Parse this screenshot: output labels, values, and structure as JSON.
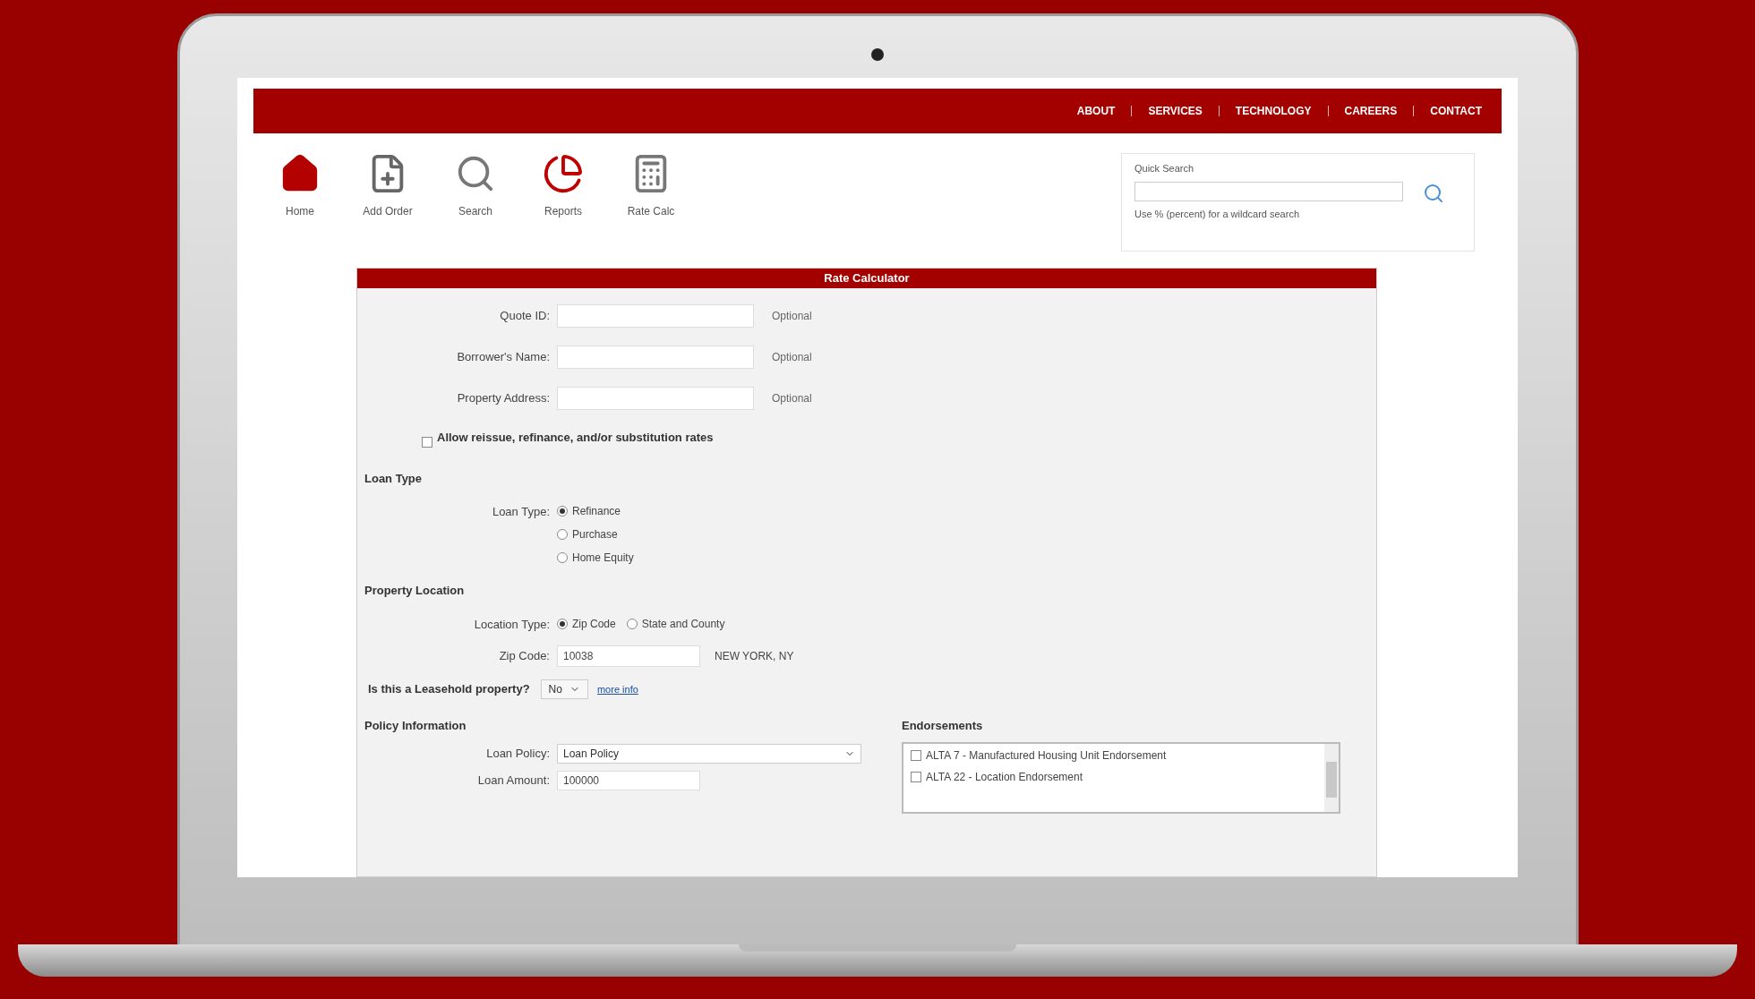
{
  "nav": {
    "links": [
      "ABOUT",
      "SERVICES",
      "TECHNOLOGY",
      "CAREERS",
      "CONTACT"
    ]
  },
  "toolbar": [
    {
      "kind": "home",
      "label": "Home"
    },
    {
      "kind": "order",
      "label": "Add Order"
    },
    {
      "kind": "search",
      "label": "Search"
    },
    {
      "kind": "reports",
      "label": "Reports"
    },
    {
      "kind": "calc",
      "label": "Rate Calc"
    }
  ],
  "quick_search": {
    "label": "Quick Search",
    "hint": "Use % (percent) for a wildcard search"
  },
  "form": {
    "title": "Rate Calculator",
    "fields": [
      {
        "label": "Quote ID:",
        "note": "Optional"
      },
      {
        "label": "Borrower's Name:",
        "note": "Optional"
      },
      {
        "label": "Property Address:",
        "note": "Optional"
      }
    ],
    "allow_reissue": {
      "label": "Allow reissue, refinance, and/or substitution rates",
      "checked": false
    },
    "loan_type": {
      "heading": "Loan Type",
      "label": "Loan Type:",
      "options": [
        {
          "label": "Refinance",
          "selected": true
        },
        {
          "label": "Purchase",
          "selected": false
        },
        {
          "label": "Home Equity",
          "selected": false
        }
      ]
    },
    "property_location": {
      "heading": "Property Location",
      "label": "Location Type:",
      "options": [
        {
          "label": "Zip Code",
          "selected": true
        },
        {
          "label": "State and County",
          "selected": false
        }
      ],
      "zip_label": "Zip Code:",
      "zip_value": "10038",
      "city": "NEW YORK, NY"
    },
    "leasehold": {
      "question": "Is this a Leasehold property?",
      "value": "No",
      "link": "more info"
    },
    "policy": {
      "heading": "Policy Information",
      "loan_policy_label": "Loan Policy:",
      "loan_policy_value": "Loan Policy",
      "loan_amount_label": "Loan Amount:",
      "loan_amount_value": "100000"
    },
    "endorsements": {
      "heading": "Endorsements",
      "items": [
        {
          "label": "ALTA 7 - Manufactured Housing Unit Endorsement",
          "checked": false
        },
        {
          "label": "ALTA 22 - Location Endorsement",
          "checked": false
        }
      ]
    }
  }
}
